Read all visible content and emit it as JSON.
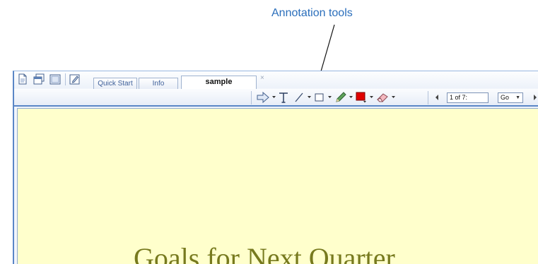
{
  "callout": {
    "text": "Annotation tools"
  },
  "tabs": [
    {
      "label": "Quick Start"
    },
    {
      "label": "Info"
    },
    {
      "label": "sample"
    }
  ],
  "tab_close_symbol": "×",
  "nav": {
    "page_field_value": "1 of 7:",
    "go_value": "Go"
  },
  "document": {
    "title": "Goals for Next Quarter"
  },
  "colors": {
    "frame_border": "#5a86c6",
    "toolbar_bg": "#e7edf7",
    "document_bg": "#ffffcc",
    "document_title": "#777a1e",
    "callout_text": "#2a6ebb",
    "annotation_color_swatch": "#e00000"
  },
  "icons": {
    "left_toolbar": [
      "document-icon",
      "windows-icon",
      "window-icon",
      "edit-icon"
    ],
    "annotation_toolbar": [
      "arrow-icon",
      "text-icon",
      "line-icon",
      "rectangle-icon",
      "pencil-icon",
      "color-swatch-icon",
      "eraser-icon"
    ],
    "navigation": [
      "previous-page-icon",
      "next-page-icon"
    ]
  }
}
